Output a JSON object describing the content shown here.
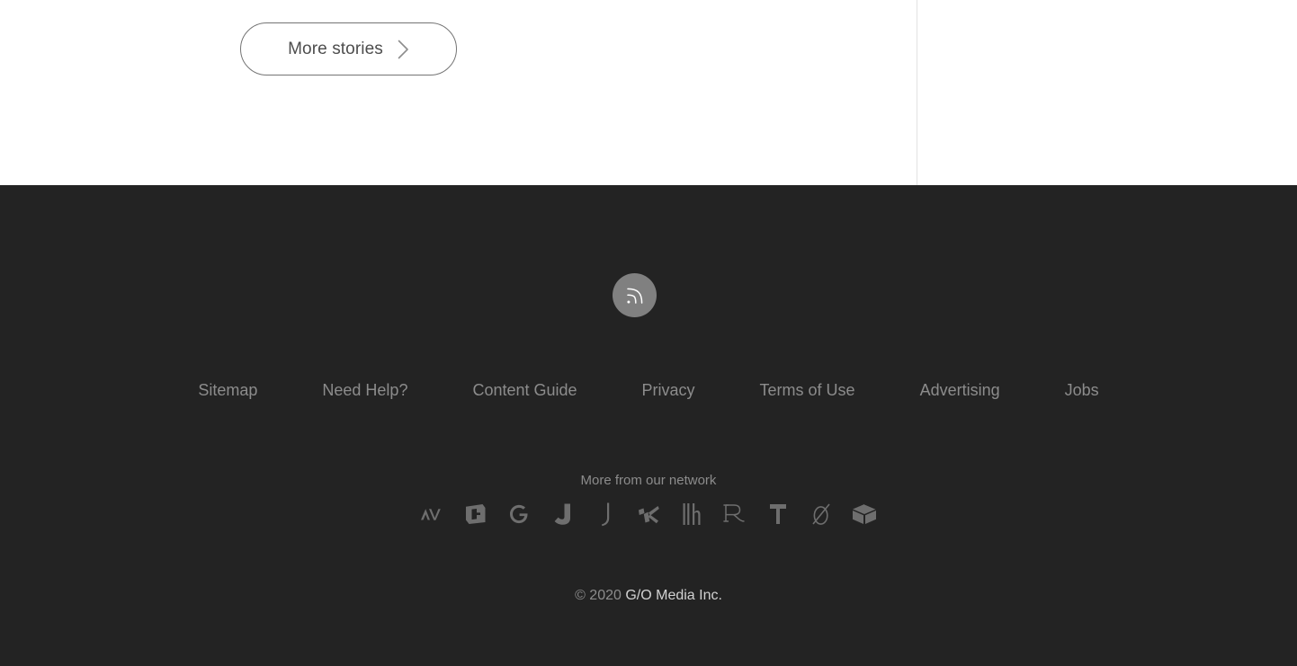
{
  "top": {
    "more_stories": {
      "label": "More stories",
      "icon": "chevron-right-icon"
    },
    "divider_color": "#e2e2e2",
    "background": "#ffffff"
  },
  "footer": {
    "background": "#232323",
    "rss": {
      "icon": "rss-icon",
      "circle_color": "#808080",
      "glyph_color": "#ffffff"
    },
    "nav_links": [
      {
        "label": "Sitemap"
      },
      {
        "label": "Need Help?"
      },
      {
        "label": "Content Guide"
      },
      {
        "label": "Privacy"
      },
      {
        "label": "Terms of Use"
      },
      {
        "label": "Advertising"
      },
      {
        "label": "Jobs"
      }
    ],
    "nav_link_color": "#8c8c8c",
    "network": {
      "heading": "More from our network",
      "logos": [
        {
          "name": "avclub-logo",
          "glyph": "AV"
        },
        {
          "name": "deadspin-logo",
          "glyph": "D"
        },
        {
          "name": "gizmodo-logo",
          "glyph": "G"
        },
        {
          "name": "jalopnik-logo",
          "glyph": "J"
        },
        {
          "name": "jezebel-logo",
          "glyph": "J"
        },
        {
          "name": "kotaku-logo",
          "glyph": "K"
        },
        {
          "name": "lifehacker-logo",
          "glyph": "lh"
        },
        {
          "name": "theroot-logo",
          "glyph": "R"
        },
        {
          "name": "thetakeout-logo",
          "glyph": "T"
        },
        {
          "name": "theonion-logo",
          "glyph": "O"
        },
        {
          "name": "theinventory-logo",
          "glyph": "box"
        }
      ],
      "logo_color": "#6e6e6e"
    },
    "copyright": {
      "prefix": "© 2020 ",
      "brand": "G/O Media Inc."
    }
  }
}
